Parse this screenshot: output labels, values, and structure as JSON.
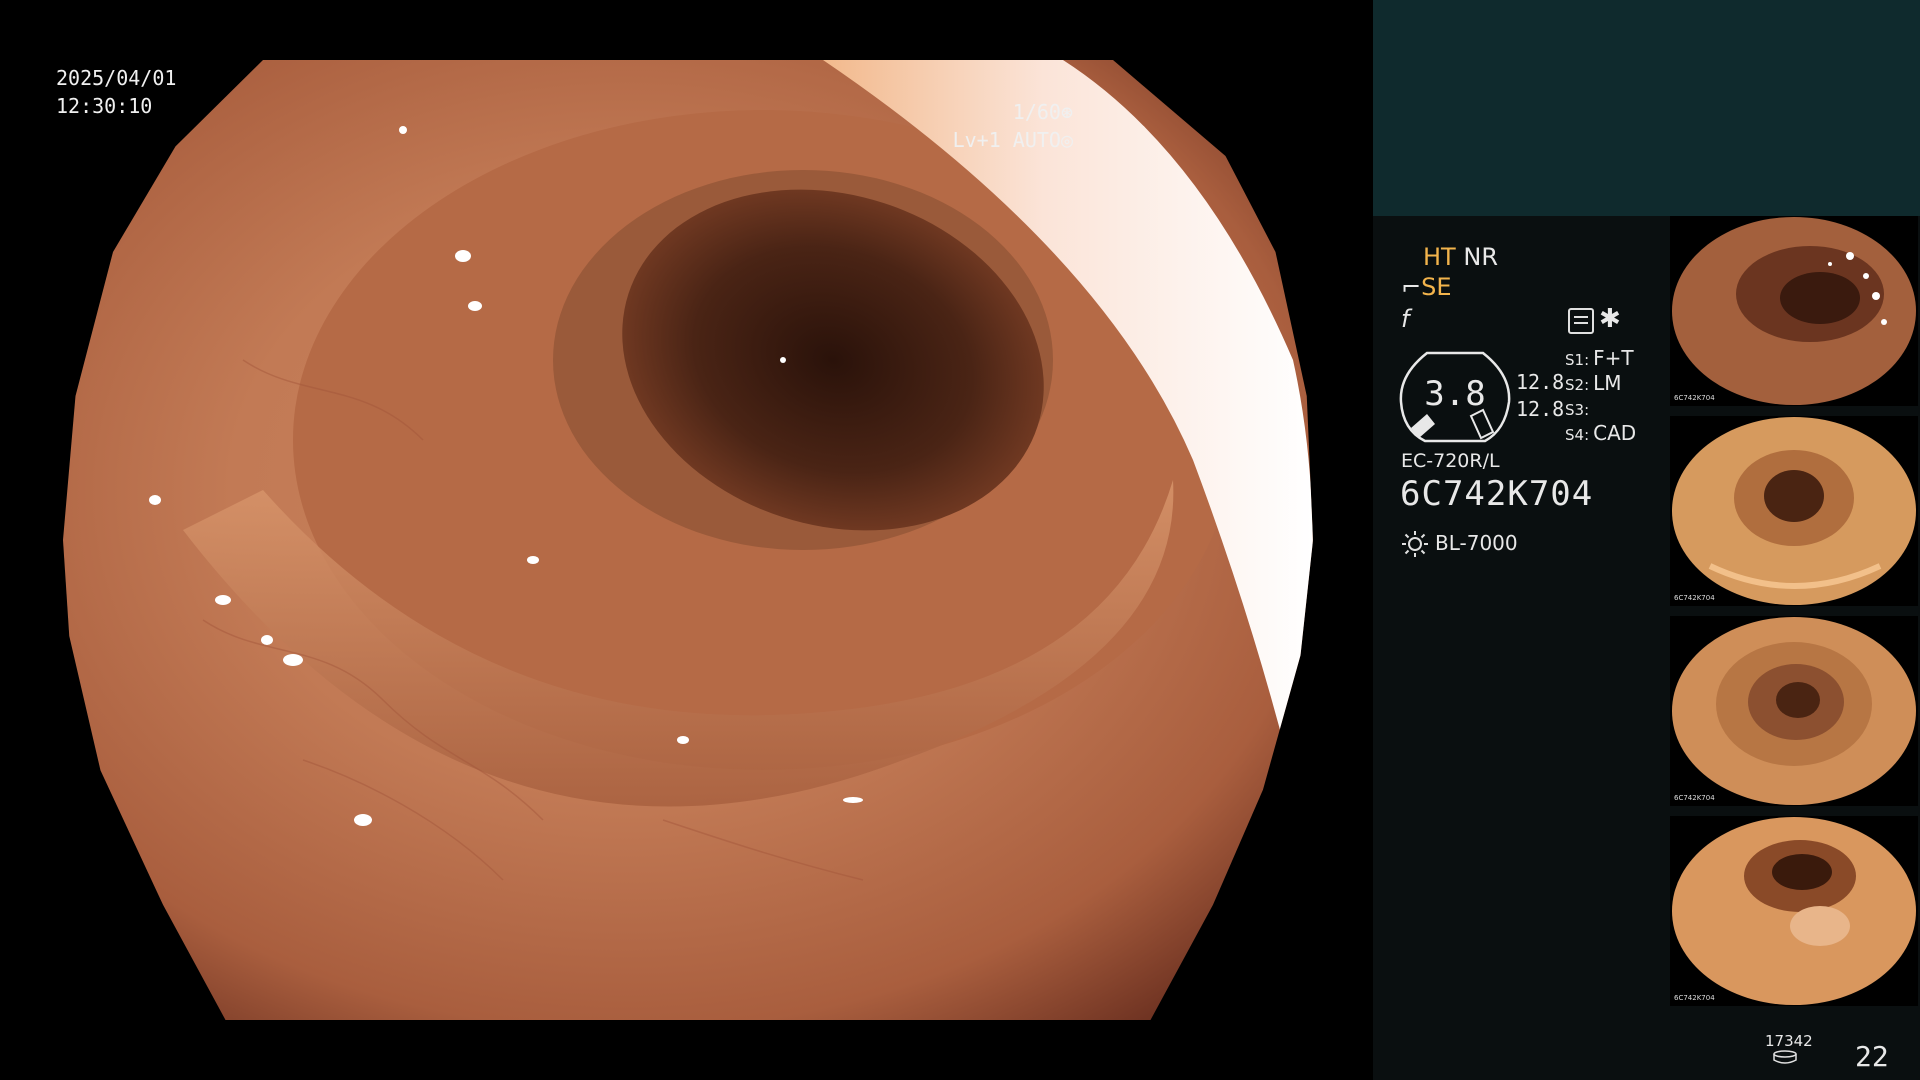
{
  "overlay": {
    "date": "2025/04/01",
    "time": "12:30:10",
    "shutter": "1/60",
    "level": "Lv+1 AUTO"
  },
  "panel": {
    "ht": "HT",
    "nr": "NR",
    "se": "SE",
    "f_symbol": "f",
    "gauge_value": "3.8",
    "value_a": "12.8",
    "value_b": "12.8",
    "slots": [
      {
        "key": "S1:",
        "value": "F+T"
      },
      {
        "key": "S2:",
        "value": "LM"
      },
      {
        "key": "S3:",
        "value": ""
      },
      {
        "key": "S4:",
        "value": "CAD"
      }
    ],
    "scope_model": "EC-720R/L",
    "scope_serial": "6C742K704",
    "lamp": "BL-7000",
    "counter_small": "17342",
    "counter_big": "22",
    "icons": {
      "stabilizer": "hand-icon",
      "menu": "menu-list-icon",
      "shutter": "shutter-icon",
      "auto": "auto-iris-icon",
      "lamp": "sun-icon",
      "storage": "disk-icon"
    },
    "colors": {
      "accent": "#f3b44c",
      "top_panel": "#0f2a2d",
      "panel_bg": "#0a0f10"
    }
  },
  "thumbnails": [
    {
      "serial": "6C742K704"
    },
    {
      "serial": "6C742K704"
    },
    {
      "serial": "6C742K704"
    },
    {
      "serial": "6C742K704"
    }
  ]
}
